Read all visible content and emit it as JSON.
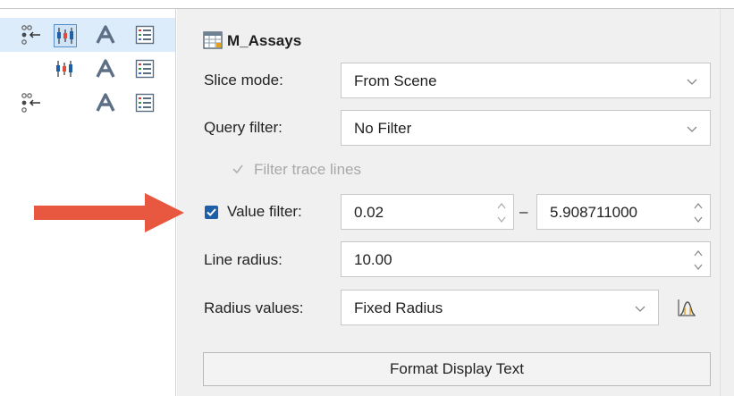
{
  "layer_title": "M_Assays",
  "fields": {
    "slice_mode": {
      "label": "Slice mode:",
      "value": "From Scene"
    },
    "query_filter": {
      "label": "Query filter:",
      "value": "No Filter"
    },
    "filter_trace": {
      "label": "Filter trace lines",
      "checked": true,
      "enabled": false
    },
    "value_filter": {
      "label": "Value filter:",
      "checked": true,
      "min": "0.02",
      "separator": "–",
      "max": "5.908711000"
    },
    "line_radius": {
      "label": "Line radius:",
      "value": "10.00"
    },
    "radius_values": {
      "label": "Radius values:",
      "value": "Fixed Radius"
    }
  },
  "format_button": "Format Display Text",
  "colors": {
    "accent": "#1f5fa8",
    "arrow": "#e8573f",
    "selected_row": "#dcecfb"
  },
  "icons": [
    "network-arrow-icon",
    "candlestick-icon",
    "text-style-icon",
    "list-icon",
    "chart-icon"
  ]
}
